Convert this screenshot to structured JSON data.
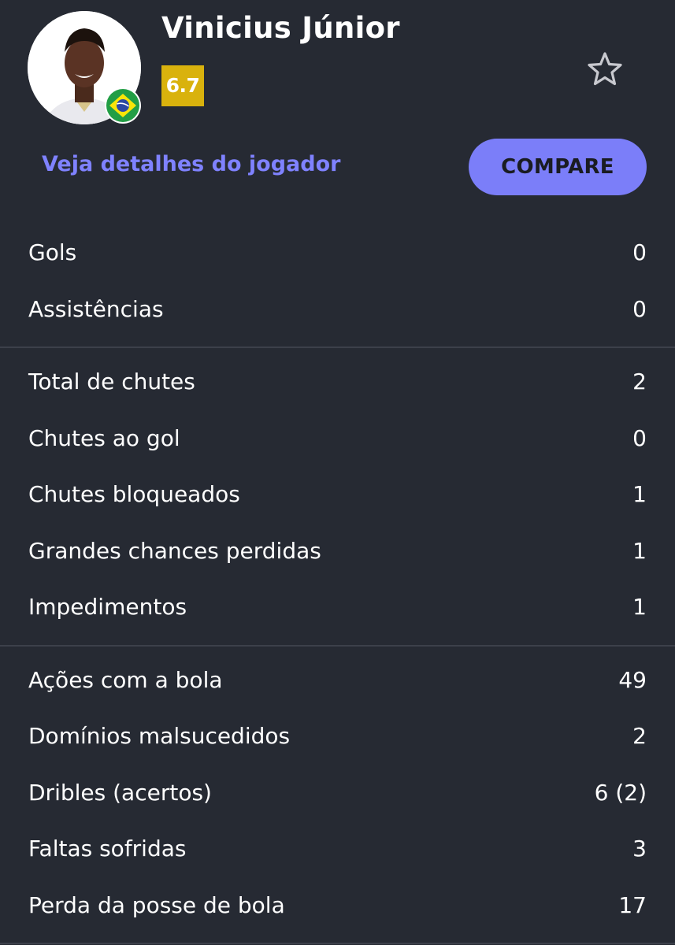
{
  "player": {
    "name": "Vinicius Júnior",
    "rating": "6.7",
    "nationality": "Brazil",
    "details_link": "Veja detalhes do jogador",
    "compare_label": "COMPARE",
    "favorite_icon": "star-outline-icon"
  },
  "colors": {
    "background": "#262a33",
    "rating_badge": "#d9b20d",
    "accent": "#7b7ef9",
    "link": "#7f82ff"
  },
  "stats": {
    "group1": [
      {
        "label": "Gols",
        "value": "0"
      },
      {
        "label": "Assistências",
        "value": "0"
      }
    ],
    "group2": [
      {
        "label": "Total de chutes",
        "value": "2"
      },
      {
        "label": "Chutes ao gol",
        "value": "0"
      },
      {
        "label": "Chutes bloqueados",
        "value": "1"
      },
      {
        "label": "Grandes chances perdidas",
        "value": "1"
      },
      {
        "label": "Impedimentos",
        "value": "1"
      }
    ],
    "group3": [
      {
        "label": "Ações com a bola",
        "value": "49"
      },
      {
        "label": "Domínios malsucedidos",
        "value": "2"
      },
      {
        "label": "Dribles (acertos)",
        "value": "6 (2)"
      },
      {
        "label": "Faltas sofridas",
        "value": "3"
      },
      {
        "label": "Perda da posse de bola",
        "value": "17"
      }
    ]
  }
}
